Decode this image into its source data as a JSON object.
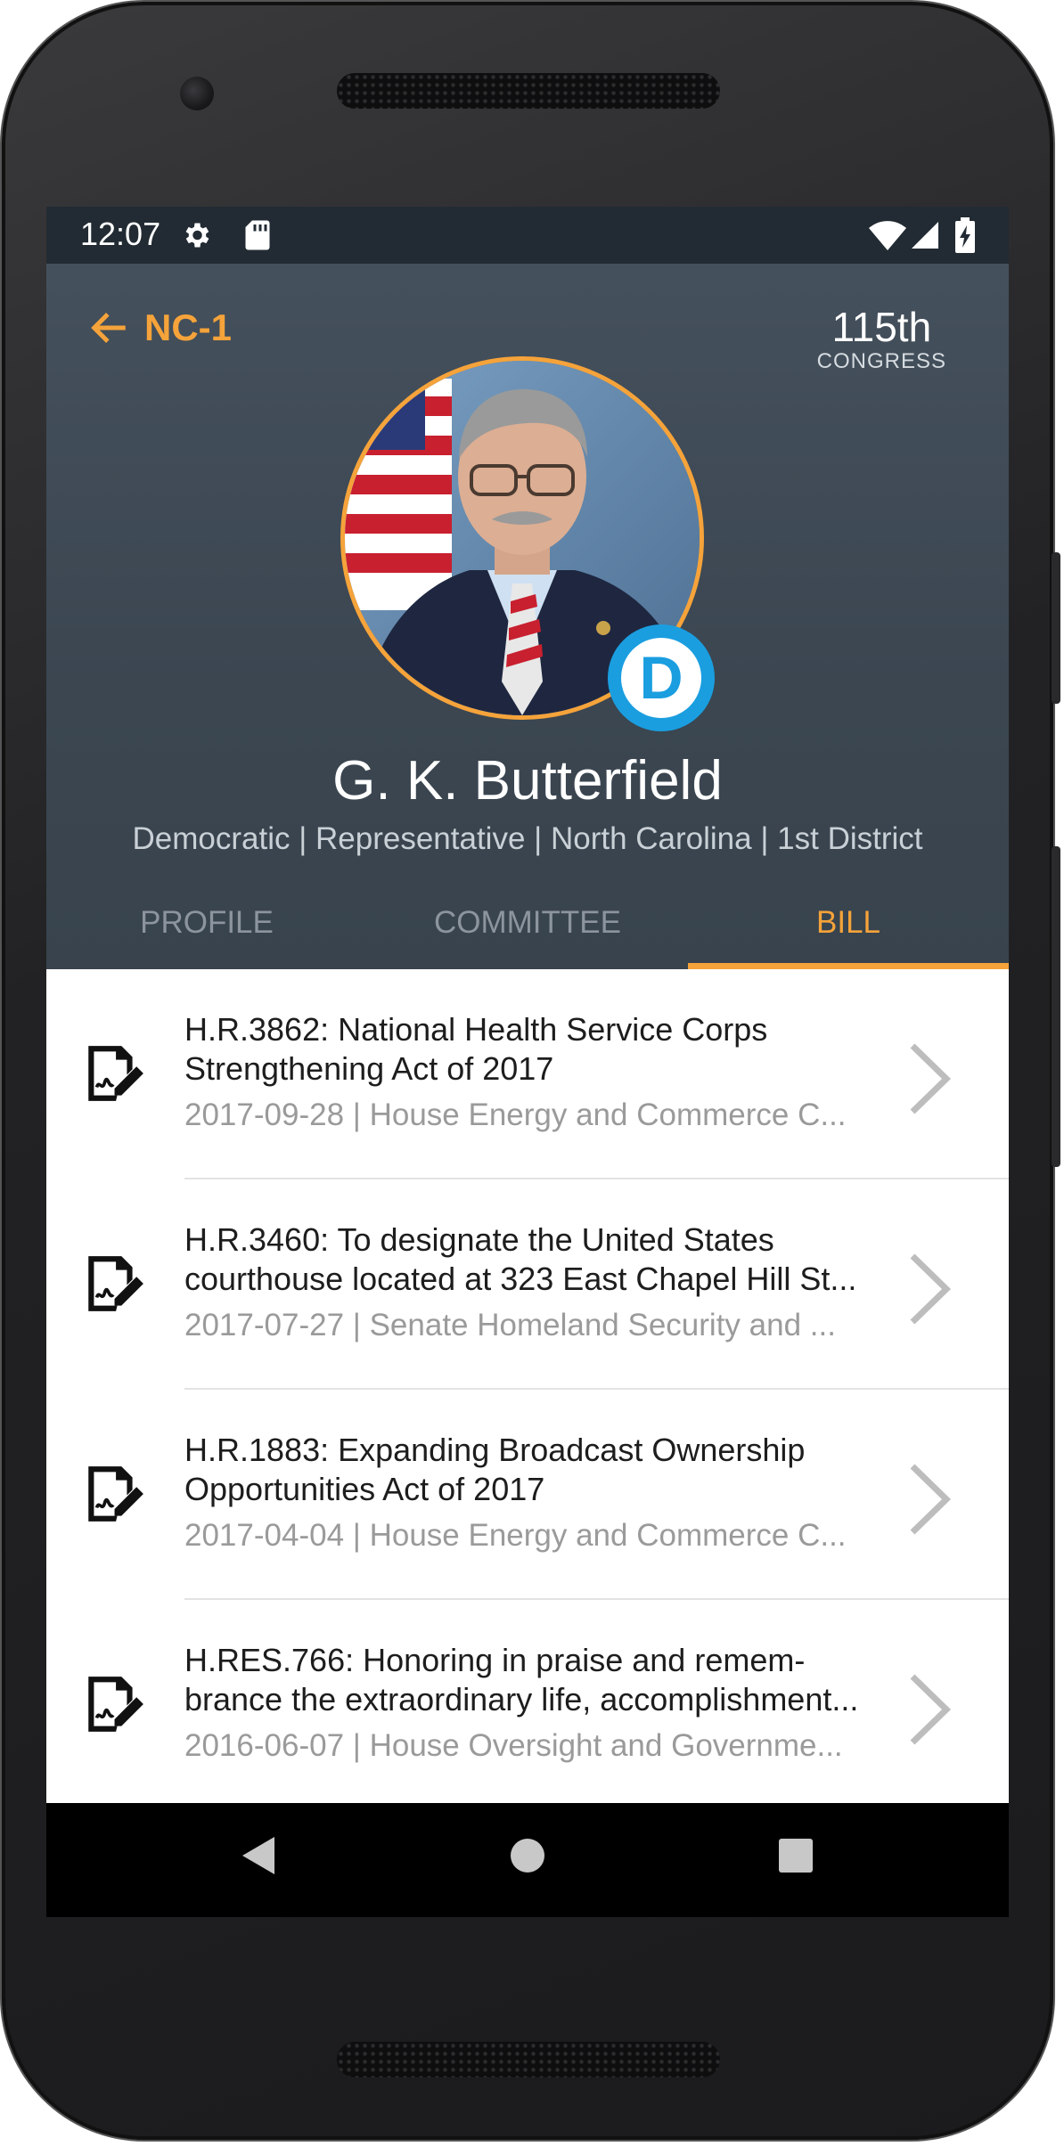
{
  "status_bar": {
    "time": "12:07",
    "icons": [
      "settings-gear-icon",
      "sd-card-icon",
      "wifi-icon",
      "signal-icon",
      "battery-charging-icon"
    ]
  },
  "header": {
    "back_icon": "arrow-left-icon",
    "district": "NC-1",
    "congress_number": "115th",
    "congress_label": "CONGRESS",
    "name": "G. K. Butterfield",
    "subtitle": "Democratic | Representative | North Carolina | 1st District",
    "party_letter": "D",
    "accent_color": "#f5a33a",
    "party_color": "#1a9ee0"
  },
  "tabs": [
    {
      "label": "PROFILE",
      "active": false
    },
    {
      "label": "COMMITTEE",
      "active": false
    },
    {
      "label": "BILL",
      "active": true
    }
  ],
  "bills": [
    {
      "title_line1": "H.R.3862: National Health Service Corps",
      "title_line2": "Strengthening Act of 2017",
      "meta": "2017-09-28 | House Energy and Commerce C..."
    },
    {
      "title_line1": "H.R.3460: To designate the United States",
      "title_line2": "courthouse located at 323 East Chapel Hill St...",
      "meta": "2017-07-27 | Senate Homeland Security and ..."
    },
    {
      "title_line1": "H.R.1883: Expanding Broadcast Ownership",
      "title_line2": "Opportunities Act of 2017",
      "meta": "2017-04-04 | House Energy and Commerce C..."
    },
    {
      "title_line1": "H.RES.766: Honoring in praise and remem-",
      "title_line2": "brance the extraordinary life, accomplishment...",
      "meta": "2016-06-07 | House Oversight and Governme..."
    }
  ],
  "nav_bar": {
    "icons": [
      "back-triangle-icon",
      "home-circle-icon",
      "recents-square-icon"
    ]
  }
}
